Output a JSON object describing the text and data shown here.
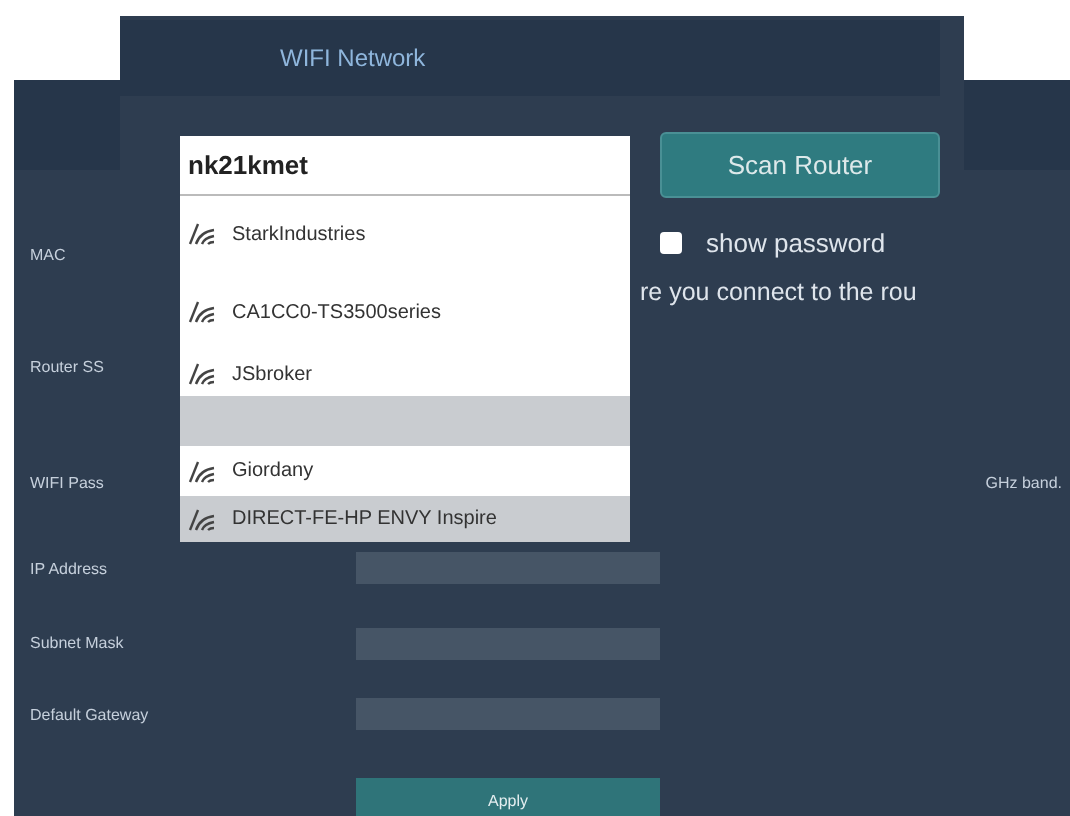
{
  "settings": {
    "labels": [
      "MAC",
      "Router SS",
      "WIFI Pass",
      "IP Address",
      "Subnet Mask",
      "Default Gateway"
    ],
    "note": "GHz band.",
    "apply": "Apply"
  },
  "dialog": {
    "title": "WIFI Network",
    "ssid": {
      "value": "nk21kmet"
    },
    "scan_button": "Scan Router",
    "show_password": {
      "label": "show password",
      "checked": false
    },
    "hint": "re you connect to the rou",
    "networks": [
      {
        "kind": "network",
        "name": "StarkIndustries",
        "shaded": false
      },
      {
        "kind": "network",
        "name": "CA1CC0-TS3500series",
        "shaded": false
      },
      {
        "kind": "network",
        "name": "JSbroker",
        "shaded": false
      },
      {
        "kind": "blank",
        "shaded": true
      },
      {
        "kind": "network",
        "name": "Giordany",
        "shaded": false
      },
      {
        "kind": "network",
        "name": "DIRECT-FE-HP ENVY Inspire",
        "shaded": true
      }
    ]
  }
}
